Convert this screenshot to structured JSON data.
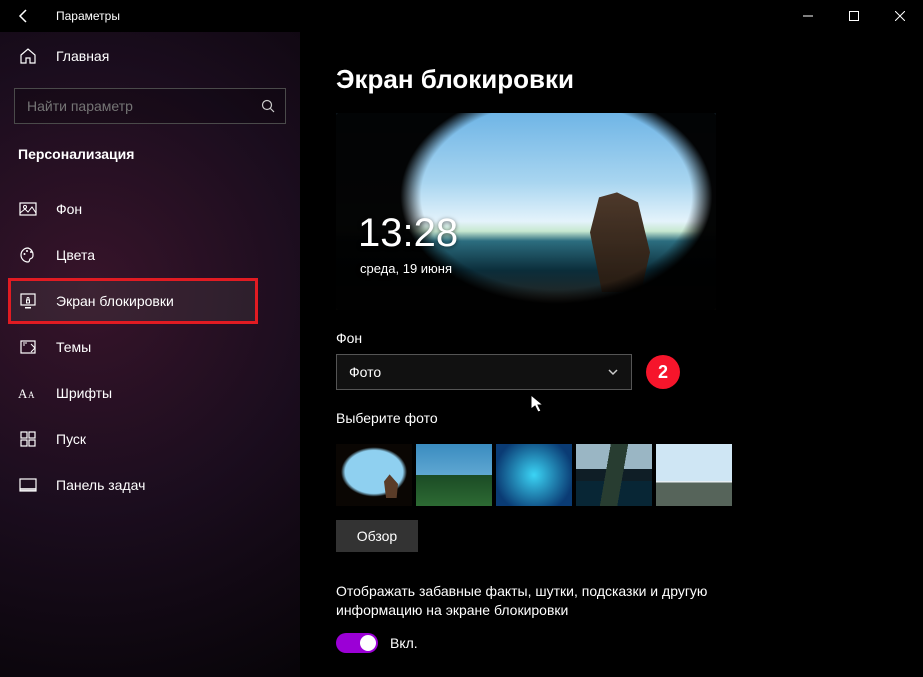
{
  "window": {
    "title": "Параметры"
  },
  "home_label": "Главная",
  "search": {
    "placeholder": "Найти параметр"
  },
  "section_title": "Персонализация",
  "nav": [
    {
      "key": "background",
      "label": "Фон"
    },
    {
      "key": "colors",
      "label": "Цвета"
    },
    {
      "key": "lockscreen",
      "label": "Экран блокировки"
    },
    {
      "key": "themes",
      "label": "Темы"
    },
    {
      "key": "fonts",
      "label": "Шрифты"
    },
    {
      "key": "start",
      "label": "Пуск"
    },
    {
      "key": "taskbar",
      "label": "Панель задач"
    }
  ],
  "page": {
    "heading": "Экран блокировки",
    "preview": {
      "time": "13:28",
      "date": "среда, 19 июня"
    },
    "background_label": "Фон",
    "background_value": "Фото",
    "annotation_badge": "2",
    "choose_photo_label": "Выберите фото",
    "browse_label": "Обзор",
    "facts_text": "Отображать забавные факты, шутки, подсказки и другую информацию на экране блокировки",
    "toggle_label": "Вкл."
  }
}
